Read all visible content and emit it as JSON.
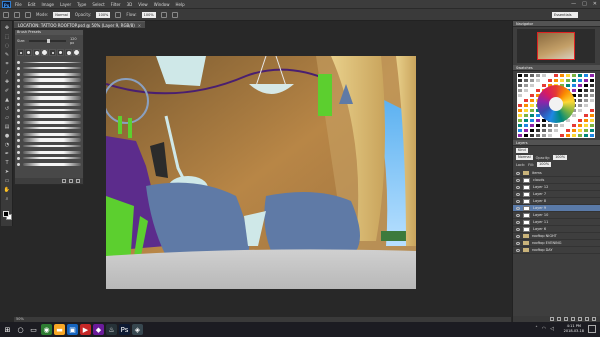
{
  "app": {
    "logo": "Ps"
  },
  "menu": [
    "File",
    "Edit",
    "Image",
    "Layer",
    "Type",
    "Select",
    "Filter",
    "3D",
    "View",
    "Window",
    "Help"
  ],
  "window_controls": [
    "—",
    "□",
    "✕"
  ],
  "options_bar": {
    "mode_label": "Mode:",
    "mode_value": "Normal",
    "opacity_label": "Opacity:",
    "opacity_value": "100%",
    "flow_label": "Flow:",
    "flow_value": "100%",
    "workspace": "Essentials"
  },
  "document_tab": {
    "title": "LOCATION: TATTOO ROOFTOP.psd @ 50% (Layer 9, RGB/8)",
    "close": "×"
  },
  "brush_panel": {
    "title": "Brush Presets",
    "size_label": "Size:",
    "size_value": "120 px"
  },
  "status_bar": {
    "zoom": "50%"
  },
  "panels": {
    "navigator": "Navigator",
    "swatches": "Swatches",
    "layers": "Layers"
  },
  "layers_panel": {
    "kind": "Kind",
    "blend": "Normal",
    "opacity_label": "Opacity:",
    "opacity_value": "100%",
    "lock_label": "Lock:",
    "fill_label": "Fill:",
    "fill_value": "100%",
    "items": [
      {
        "name": "items",
        "type": "folder"
      },
      {
        "name": "clouds",
        "type": "layer"
      },
      {
        "name": "Layer 12",
        "type": "layer"
      },
      {
        "name": "Layer 7",
        "type": "layer"
      },
      {
        "name": "Layer 8",
        "type": "layer"
      },
      {
        "name": "Layer 9",
        "type": "layer",
        "selected": true
      },
      {
        "name": "Layer 10",
        "type": "layer"
      },
      {
        "name": "Layer 11",
        "type": "layer"
      },
      {
        "name": "Layer 6",
        "type": "layer"
      },
      {
        "name": "rooftop NIGHT",
        "type": "folder"
      },
      {
        "name": "rooftop EVENING",
        "type": "folder"
      },
      {
        "name": "rooftop DAY",
        "type": "folder"
      }
    ]
  },
  "taskbar": {
    "icons": [
      {
        "name": "windows-start-icon",
        "glyph": "⊞",
        "color": "#1c1c22"
      },
      {
        "name": "search-icon",
        "glyph": "○",
        "color": "#1c1c22"
      },
      {
        "name": "task-view-icon",
        "glyph": "▭",
        "color": "#1c1c22"
      },
      {
        "name": "chrome-icon",
        "glyph": "◉",
        "color": "#2e7d32"
      },
      {
        "name": "file-explorer-icon",
        "glyph": "▬",
        "color": "#f9a825"
      },
      {
        "name": "store-icon",
        "glyph": "▣",
        "color": "#1565c0"
      },
      {
        "name": "media-icon",
        "glyph": "▶",
        "color": "#c62828"
      },
      {
        "name": "app-icon",
        "glyph": "◆",
        "color": "#6a1b9a"
      },
      {
        "name": "steam-icon",
        "glyph": "♨",
        "color": "#263238"
      },
      {
        "name": "photoshop-taskbar-icon",
        "glyph": "Ps",
        "color": "#0d1a33"
      },
      {
        "name": "app2-icon",
        "glyph": "◈",
        "color": "#37474f"
      }
    ],
    "time": "4:11 PM",
    "date": "2018-03-18"
  },
  "colors": {
    "canvas_bg": "#b07a3a",
    "green_ui": "#5ccf2f",
    "purple": "#5c2c8c",
    "pillow_blue": "#5f7aa6"
  }
}
